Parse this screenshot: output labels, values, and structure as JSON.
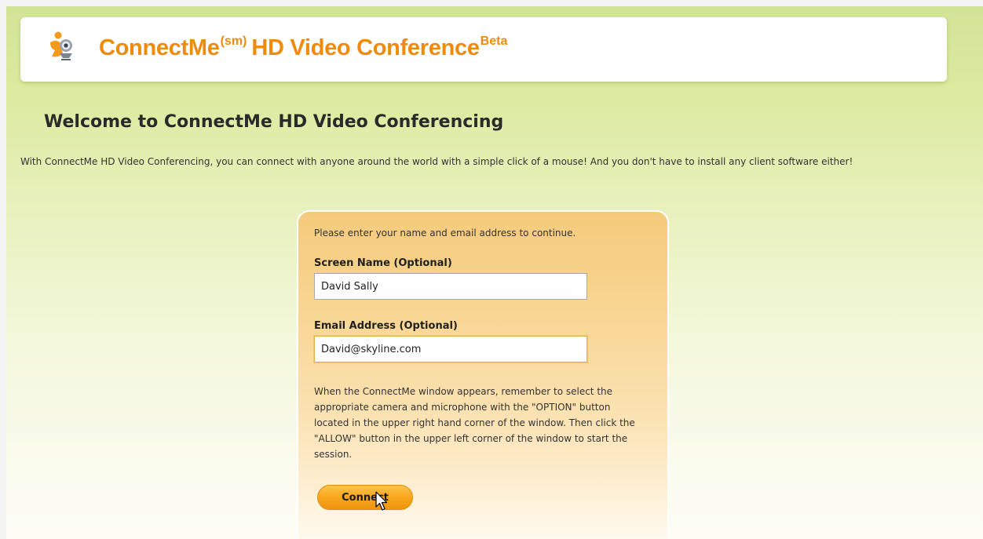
{
  "header": {
    "brand_name": "ConnectMe",
    "brand_sup": "(sm)",
    "brand_rest": "HD Video Conference",
    "brand_beta": "Beta",
    "logo_icon": "people-webcam-logo-icon"
  },
  "main": {
    "welcome_title": "Welcome to ConnectMe HD Video Conferencing",
    "intro_text": "With ConnectMe HD Video Conferencing, you can connect with anyone around the world with a simple click of a mouse! And you don't have to install any client software either!"
  },
  "form": {
    "panel_intro": "Please enter your name and email address to continue.",
    "screen_name_label": "Screen Name (Optional)",
    "screen_name_value": "David Sally",
    "email_label": "Email Address (Optional)",
    "email_value": "David@skyline.com",
    "instructions": "When the ConnectMe window appears, remember to select the appropriate camera and microphone with the \"OPTION\" button located in the upper right hand corner of the window. Then click the \"ALLOW\" button in the upper left corner of the window to start the session.",
    "connect_label": "Connect"
  },
  "colors": {
    "brand": "#ee8b0c",
    "background": "#d2e497",
    "panel": "#f8d591",
    "button": "#f8a319"
  },
  "cursor_icon": "mouse-pointer-icon"
}
